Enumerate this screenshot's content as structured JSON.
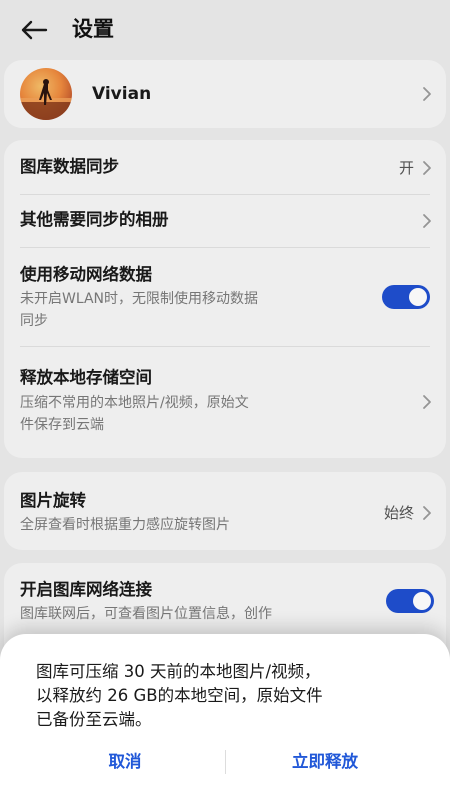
{
  "header": {
    "title": "设置",
    "back_icon": "back-arrow-icon"
  },
  "account": {
    "name": "Vivian"
  },
  "sync_card": {
    "gallery_sync": {
      "label": "图库数据同步",
      "value": "开"
    },
    "other_albums": {
      "label": "其他需要同步的相册"
    },
    "mobile_data": {
      "label": "使用移动网络数据",
      "desc_line1": "未开启WLAN时，无限制使用移动数据",
      "desc_line2": "同步",
      "enabled": true
    },
    "free_storage": {
      "label": "释放本地存储空间",
      "desc_line1": "压缩不常用的本地照片/视频，原始文",
      "desc_line2": "件保存到云端"
    }
  },
  "rotate_card": {
    "label": "图片旋转",
    "desc": "全屏查看时根据重力感应旋转图片",
    "value": "始终"
  },
  "network_card": {
    "label": "开启图库网络连接",
    "desc": "图库联网后，可查看图片位置信息，创作",
    "enabled": true
  },
  "dialog": {
    "message_line1": "图库可压缩 30 天前的本地图片/视频，",
    "message_line2": "以释放约 26 GB的本地空间，原始文件",
    "message_line3": "已备份至云端。",
    "cancel_label": "取消",
    "confirm_label": "立即释放"
  },
  "colors": {
    "accent": "#2158d8",
    "toggle_on": "#1f4fd0",
    "background": "#ececec",
    "card": "#f6f6f6"
  }
}
